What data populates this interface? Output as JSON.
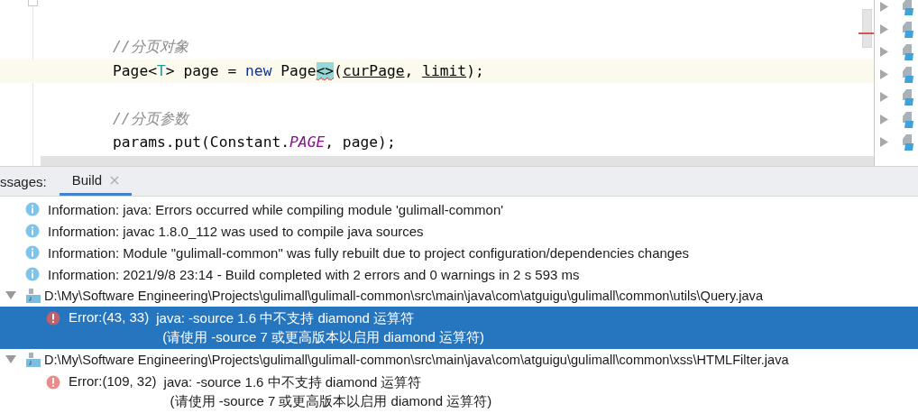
{
  "editor": {
    "lines": [
      {
        "current": false
      },
      {
        "current": false
      },
      {
        "current": false,
        "tokens": [
          {
            "kind": "comment",
            "text": "//分页对象"
          }
        ]
      },
      {
        "current": true,
        "tokens": [
          {
            "kind": "plain",
            "text": "Page<"
          },
          {
            "kind": "type-param",
            "text": "T"
          },
          {
            "kind": "plain",
            "text": "> page = "
          },
          {
            "kind": "keyword",
            "text": "new"
          },
          {
            "kind": "plain",
            "text": " Page"
          },
          {
            "kind": "error-match",
            "text": "<>"
          },
          {
            "kind": "plain",
            "text": "("
          },
          {
            "kind": "underlined",
            "text": "curPage"
          },
          {
            "kind": "plain",
            "text": ", "
          },
          {
            "kind": "underlined",
            "text": "limit"
          },
          {
            "kind": "plain",
            "text": ");"
          }
        ]
      },
      {
        "current": false
      },
      {
        "current": false,
        "tokens": [
          {
            "kind": "comment",
            "text": "//分页参数"
          }
        ]
      },
      {
        "current": false,
        "tokens": [
          {
            "kind": "plain",
            "text": "params.put(Constant."
          },
          {
            "kind": "constant",
            "text": "PAGE"
          },
          {
            "kind": "plain",
            "text": ", page);"
          }
        ]
      }
    ]
  },
  "structure": {
    "items": [
      {
        "expanded": false
      },
      {
        "expanded": false
      },
      {
        "expanded": false
      },
      {
        "expanded": false
      },
      {
        "expanded": false
      },
      {
        "expanded": false
      },
      {
        "expanded": false
      }
    ]
  },
  "messages": {
    "label": "ssages:",
    "tabs": [
      {
        "label": "Build",
        "selected": true
      }
    ],
    "items": [
      {
        "kind": "info",
        "text": "Information: java: Errors occurred while compiling module 'gulimall-common'"
      },
      {
        "kind": "info",
        "text": "Information: javac 1.8.0_112 was used to compile java sources"
      },
      {
        "kind": "info",
        "text": "Information: Module \"gulimall-common\" was fully rebuilt due to project configuration/dependencies changes"
      },
      {
        "kind": "info",
        "text": "Information: 2021/9/8 23:14 - Build completed with 2 errors and 0 warnings in 2 s 593 ms"
      },
      {
        "kind": "file",
        "text": "D:\\My\\Software Engineering\\Projects\\gulimall\\gulimall-common\\src\\main\\java\\com\\atguigu\\gulimall\\common\\utils\\Query.java",
        "expanded": true,
        "children": [
          {
            "kind": "error",
            "location": "Error:(43, 33)",
            "text": "java: -source 1.6 中不支持 diamond 运算符",
            "detail": "(请使用 -source 7 或更高版本以启用 diamond 运算符)",
            "selected": true
          }
        ]
      },
      {
        "kind": "file",
        "text": "D:\\My\\Software Engineering\\Projects\\gulimall\\gulimall-common\\src\\main\\java\\com\\atguigu\\gulimall\\common\\xss\\HTMLFilter.java",
        "expanded": true,
        "children": [
          {
            "kind": "error",
            "location": "Error:(109, 32)",
            "text": "java: -source 1.6 中不支持 diamond 运算符",
            "detail": "(请使用 -source 7 或更高版本以启用 diamond 运算符)",
            "selected": false
          }
        ]
      }
    ]
  }
}
